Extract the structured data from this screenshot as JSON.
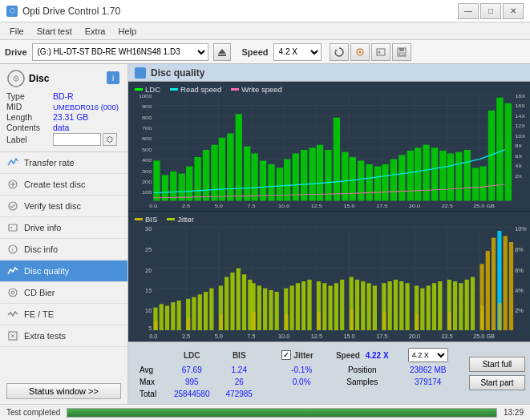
{
  "app": {
    "title": "Opti Drive Control 1.70",
    "icon": "⬡"
  },
  "titlebar": {
    "title": "Opti Drive Control 1.70",
    "minimize": "—",
    "maximize": "□",
    "close": "✕"
  },
  "menubar": {
    "items": [
      "File",
      "Start test",
      "Extra",
      "Help"
    ]
  },
  "drivebar": {
    "drive_label": "Drive",
    "drive_value": "(G:) HL-DT-ST BD-RE  WH16NS48 1.D3",
    "speed_label": "Speed",
    "speed_value": "4.2 X"
  },
  "disc": {
    "header": "Disc",
    "type_label": "Type",
    "type_value": "BD-R",
    "mid_label": "MID",
    "mid_value": "UMEBDR016 (000)",
    "length_label": "Length",
    "length_value": "23.31 GB",
    "contents_label": "Contents",
    "contents_value": "data",
    "label_label": "Label",
    "label_value": ""
  },
  "nav": {
    "items": [
      {
        "id": "transfer-rate",
        "label": "Transfer rate",
        "active": false
      },
      {
        "id": "create-test-disc",
        "label": "Create test disc",
        "active": false
      },
      {
        "id": "verify-test-disc",
        "label": "Verify test disc",
        "active": false
      },
      {
        "id": "drive-info",
        "label": "Drive info",
        "active": false
      },
      {
        "id": "disc-info",
        "label": "Disc info",
        "active": false
      },
      {
        "id": "disc-quality",
        "label": "Disc quality",
        "active": true
      },
      {
        "id": "cd-bier",
        "label": "CD Bier",
        "active": false
      },
      {
        "id": "fe-te",
        "label": "FE / TE",
        "active": false
      },
      {
        "id": "extra-tests",
        "label": "Extra tests",
        "active": false
      }
    ],
    "status_btn": "Status window >>"
  },
  "disc_quality": {
    "title": "Disc quality",
    "legend": {
      "ldc": "LDC",
      "read_speed": "Read speed",
      "write_speed": "Write speed",
      "bis": "BIS",
      "jitter": "Jitter"
    },
    "chart1_y_right": [
      "18X",
      "16X",
      "14X",
      "12X",
      "10X",
      "8X",
      "6X",
      "4X",
      "2X"
    ],
    "chart1_y_left": [
      "1000",
      "900",
      "800",
      "700",
      "600",
      "500",
      "400",
      "300",
      "200",
      "100"
    ],
    "chart2_y_right": [
      "10%",
      "8%",
      "6%",
      "4%",
      "2%"
    ],
    "chart2_y_left": [
      "30",
      "25",
      "20",
      "15",
      "10",
      "5"
    ],
    "x_axis": [
      "0.0",
      "2.5",
      "5.0",
      "7.5",
      "10.0",
      "12.5",
      "15.0",
      "17.5",
      "20.0",
      "22.5",
      "25.0 GB"
    ]
  },
  "stats": {
    "headers": [
      "LDC",
      "BIS",
      "",
      "Jitter",
      "Speed",
      "4.22 X"
    ],
    "speed_select": "4.2 X",
    "avg_label": "Avg",
    "avg_ldc": "67.69",
    "avg_bis": "1.24",
    "avg_jitter": "-0.1%",
    "max_label": "Max",
    "max_ldc": "995",
    "max_bis": "26",
    "max_jitter": "0.0%",
    "total_label": "Total",
    "total_ldc": "25844580",
    "total_bis": "472985",
    "position_label": "Position",
    "position_value": "23862 MB",
    "samples_label": "Samples",
    "samples_value": "379174",
    "start_full": "Start full",
    "start_part": "Start part"
  },
  "statusbar": {
    "text": "Test completed",
    "progress": 100,
    "time": "13:29"
  },
  "colors": {
    "accent_blue": "#4a90d9",
    "active_nav_bg": "#4a90d9",
    "chart_bg": "#2a3a4a",
    "ldc_color": "#00ff00",
    "bis_color": "#c8b400",
    "jitter_color": "#a0d000",
    "read_speed_color": "#00e8e8",
    "write_speed_color": "#ff69b4"
  }
}
